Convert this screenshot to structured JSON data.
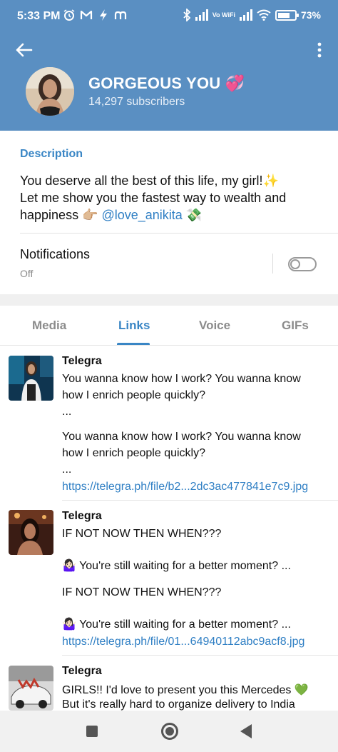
{
  "status_bar": {
    "time": "5:33 PM",
    "icons_left": [
      "alarm-icon",
      "gmail-icon",
      "lightning-icon",
      "m-icon"
    ],
    "battery": "73%",
    "battery_level": 0.73,
    "vowifi": "Vo WiFi"
  },
  "header": {
    "title": "GORGEOUS YOU 💞",
    "subscribers": "14,297 subscribers",
    "background_color": "#5a8fc2"
  },
  "description": {
    "label": "Description",
    "line1": "You deserve all the best of this life, my girl!✨",
    "line2": "Let me show you the fastest way to wealth and",
    "line3_start": "happiness 👉🏼 ",
    "mention": "@love_anikita",
    "line3_end": " 💸"
  },
  "notifications": {
    "label": "Notifications",
    "state": "Off",
    "enabled": false
  },
  "tabs": [
    {
      "label": "Media",
      "active": false
    },
    {
      "label": "Links",
      "active": true
    },
    {
      "label": "Voice",
      "active": false
    },
    {
      "label": "GIFs",
      "active": false
    }
  ],
  "links": [
    {
      "title": "Telegra",
      "lines": [
        "You wanna know how I work? You wanna know",
        "how I enrich people quickly?",
        "...",
        "You wanna know how I work? You wanna know",
        "how I enrich people quickly?",
        "..."
      ],
      "url": "https://telegra.ph/file/b2...2dc3ac477841e7c9.jpg"
    },
    {
      "title": "Telegra",
      "lines": [
        "IF NOT NOW THEN WHEN???",
        "🤷🏻‍♀️ You're still waiting for a better moment? ...",
        "IF NOT NOW THEN WHEN???",
        "🤷🏻‍♀️ You're still waiting for a better moment? ..."
      ],
      "url": "https://telegra.ph/file/01...64940112abc9acf8.jpg"
    },
    {
      "title": "Telegra",
      "lines": [
        "GIRLS!! I'd love to present you this Mercedes 💚",
        "But it's really hard to organize delivery to India"
      ]
    }
  ],
  "accent_color": "#3a86c5"
}
